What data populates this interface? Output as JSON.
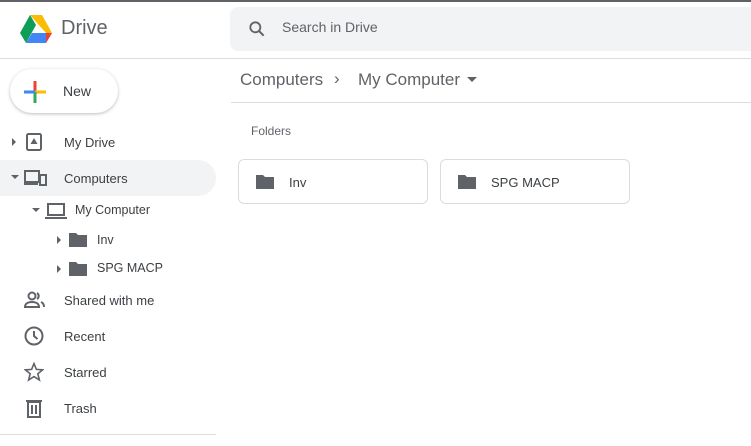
{
  "app": {
    "title": "Drive"
  },
  "search": {
    "placeholder": "Search in Drive"
  },
  "new_button": "New",
  "sidebar": {
    "my_drive": "My Drive",
    "computers": "Computers",
    "my_computer": "My Computer",
    "folders": [
      "Inv",
      "SPG MACP"
    ],
    "shared": "Shared with me",
    "recent": "Recent",
    "starred": "Starred",
    "trash": "Trash"
  },
  "breadcrumb": [
    "Computers",
    "My Computer"
  ],
  "main": {
    "section_label": "Folders",
    "folders": [
      "Inv",
      "SPG MACP"
    ]
  },
  "colors": {
    "icon": "#5f6368",
    "selected_bg": "#f1f3f4"
  }
}
